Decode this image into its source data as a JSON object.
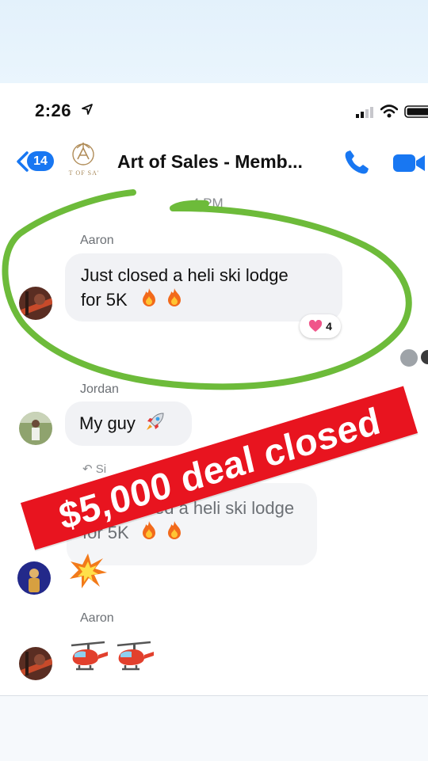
{
  "status_bar": {
    "time": "2:26"
  },
  "header": {
    "back_count": "14",
    "logo_text": "T OF SA'",
    "title": "Art of Sales - Memb..."
  },
  "thread": {
    "time_divider": "4 PM",
    "messages": [
      {
        "sender": "Aaron",
        "text_line1": "Just closed a heli ski lodge",
        "text_line2": "for 5K",
        "reaction_count": "4"
      },
      {
        "sender": "Jordan",
        "text": "My guy"
      },
      {
        "reply_label": "Si",
        "quoted_line1": "sed a heli ski lodge",
        "quoted_line2": "for 5K"
      },
      {
        "sender": "Aaron"
      }
    ]
  },
  "overlay": {
    "banner_text": "$5,000 deal closed"
  },
  "colors": {
    "accent": "#1877f2",
    "bubble": "#f1f2f5",
    "banner": "#e8141f",
    "annotation_stroke": "#6dbb3a"
  },
  "icons": [
    "location-arrow-icon",
    "signal-icon",
    "wifi-icon",
    "battery-icon",
    "back-chevron-icon",
    "phone-icon",
    "video-icon",
    "fire-emoji",
    "rocket-emoji",
    "collision-emoji",
    "helicopter-emoji",
    "heart-icon",
    "reply-arrow-icon"
  ]
}
